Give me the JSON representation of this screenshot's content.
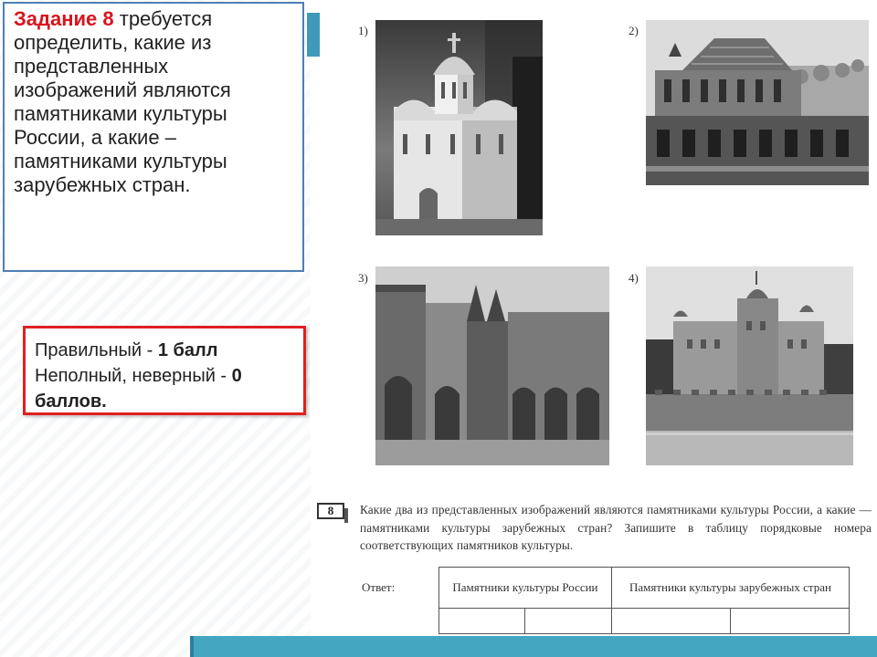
{
  "task": {
    "title": "Задание 8",
    "text": " требуется определить, какие из представленных изображений являются памятниками культуры России, а какие – памятниками культуры зарубежных стран."
  },
  "scoring": {
    "line1_prefix": "Правильный - ",
    "line1_bold": "1 балл",
    "line2_prefix": "Неполный, неверный - ",
    "line2_bold": "0 баллов."
  },
  "photos": [
    {
      "label": "1)"
    },
    {
      "label": "2)"
    },
    {
      "label": "3)"
    },
    {
      "label": "4)"
    }
  ],
  "question": {
    "number": "8",
    "text": "Какие два из представленных изображений являются памятниками культуры России, а какие — памятниками культуры зарубежных стран? Запишите в таблицу порядковые номера соответствующих памятников культуры.",
    "answer_label": "Ответ:",
    "table_headers": [
      "Памятники культуры России",
      "Памятники культуры зарубежных стран"
    ]
  }
}
